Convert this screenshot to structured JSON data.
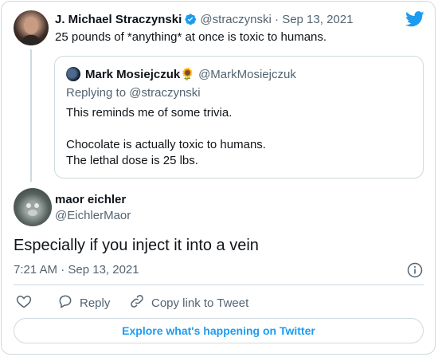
{
  "main_tweet": {
    "author_name": "J. Michael Straczynski",
    "author_handle": "@straczynski",
    "date": "Sep 13, 2021",
    "separator": "·",
    "text": "25 pounds of *anything* at once is toxic to humans."
  },
  "quoted_tweet": {
    "author_name": "Mark Mosiejczuk",
    "author_emoji": "🌻",
    "author_handle": "@MarkMosiejczuk",
    "replying_to": "Replying to @straczynski",
    "line1": "This reminds me of some trivia.",
    "line2": "Chocolate is actually toxic to humans.",
    "line3": "The lethal dose is 25 lbs."
  },
  "reply_tweet": {
    "author_name": "maor eichler",
    "author_handle": "@EichlerMaor",
    "text": "Especially if you inject it into a vein",
    "timestamp": "7:21 AM · Sep 13, 2021"
  },
  "actions": {
    "reply_label": "Reply",
    "copy_link_label": "Copy link to Tweet"
  },
  "footer": {
    "explore_label": "Explore what's happening on Twitter"
  },
  "colors": {
    "twitter_blue": "#1d9bf0",
    "muted": "#536471",
    "border": "#cfd9de"
  },
  "icons": [
    "twitter-logo-icon",
    "verified-badge-icon",
    "info-icon",
    "heart-icon",
    "reply-icon",
    "link-icon"
  ]
}
